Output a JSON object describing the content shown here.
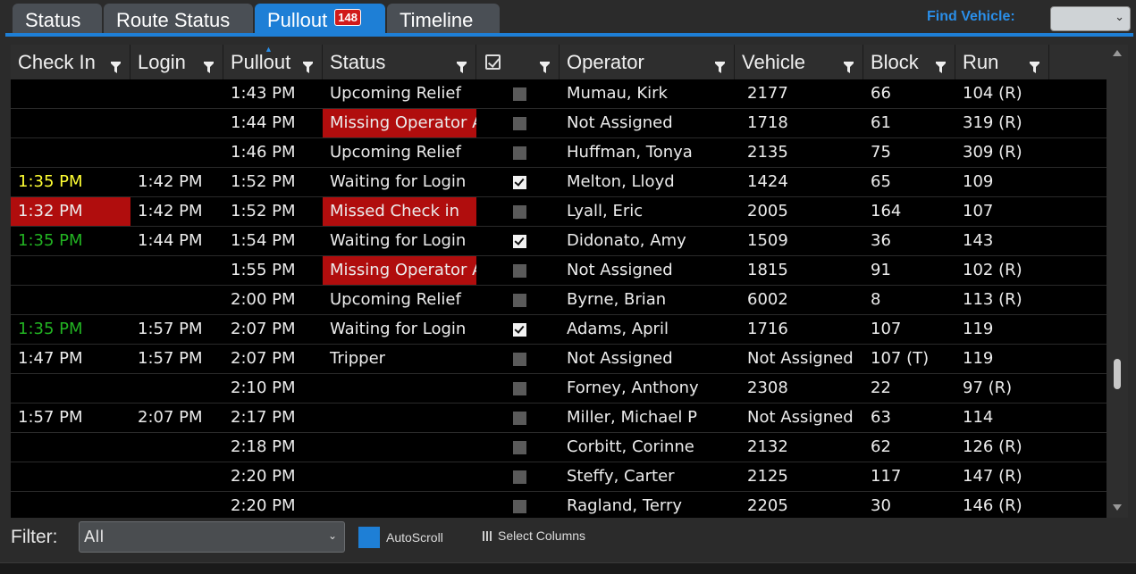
{
  "tabs": [
    {
      "label": "Status",
      "badge": null
    },
    {
      "label": "Route Status",
      "badge": null
    },
    {
      "label": "Pullout",
      "badge": "148"
    },
    {
      "label": "Timeline",
      "badge": null
    }
  ],
  "find_vehicle": {
    "label": "Find Vehicle:",
    "value": ""
  },
  "columns": [
    "Check In",
    "Login",
    "Pullout",
    "Status",
    "",
    "Operator",
    "Vehicle",
    "Block",
    "Run"
  ],
  "rows": [
    {
      "checkin": "",
      "checkin_style": "",
      "login": "",
      "pullout": "1:43 PM",
      "status": "Upcoming Relief",
      "status_style": "",
      "checked": false,
      "operator": "Mumau, Kirk",
      "vehicle": "2177",
      "block": "66",
      "run": "104 (R)"
    },
    {
      "checkin": "",
      "checkin_style": "",
      "login": "",
      "pullout": "1:44 PM",
      "status": "Missing Operator Assignment",
      "status_style": "red",
      "checked": false,
      "operator": "Not Assigned",
      "vehicle": "1718",
      "block": "61",
      "run": "319 (R)"
    },
    {
      "checkin": "",
      "checkin_style": "",
      "login": "",
      "pullout": "1:46 PM",
      "status": "Upcoming Relief",
      "status_style": "",
      "checked": false,
      "operator": "Huffman, Tonya",
      "vehicle": "2135",
      "block": "75",
      "run": "309 (R)"
    },
    {
      "checkin": "1:35 PM",
      "checkin_style": "yellow",
      "login": "1:42 PM",
      "pullout": "1:52 PM",
      "status": "Waiting for Login",
      "status_style": "",
      "checked": true,
      "operator": "Melton, Lloyd",
      "vehicle": "1424",
      "block": "65",
      "run": "109"
    },
    {
      "checkin": "1:32 PM",
      "checkin_style": "red",
      "login": "1:42 PM",
      "pullout": "1:52 PM",
      "status": "Missed Check in",
      "status_style": "red",
      "checked": false,
      "operator": "Lyall, Eric",
      "vehicle": "2005",
      "block": "164",
      "run": "107"
    },
    {
      "checkin": "1:35 PM",
      "checkin_style": "green",
      "login": "1:44 PM",
      "pullout": "1:54 PM",
      "status": "Waiting for Login",
      "status_style": "",
      "checked": true,
      "operator": "Didonato, Amy",
      "vehicle": "1509",
      "block": "36",
      "run": "143"
    },
    {
      "checkin": "",
      "checkin_style": "",
      "login": "",
      "pullout": "1:55 PM",
      "status": "Missing Operator Assignment",
      "status_style": "red",
      "checked": false,
      "operator": "Not Assigned",
      "vehicle": "1815",
      "block": "91",
      "run": "102 (R)"
    },
    {
      "checkin": "",
      "checkin_style": "",
      "login": "",
      "pullout": "2:00 PM",
      "status": "Upcoming Relief",
      "status_style": "",
      "checked": false,
      "operator": "Byrne, Brian",
      "vehicle": "6002",
      "block": "8",
      "run": "113 (R)"
    },
    {
      "checkin": "1:35 PM",
      "checkin_style": "green",
      "login": "1:57 PM",
      "pullout": "2:07 PM",
      "status": "Waiting for Login",
      "status_style": "",
      "checked": true,
      "operator": "Adams, April",
      "vehicle": "1716",
      "block": "107",
      "run": "119"
    },
    {
      "checkin": "1:47 PM",
      "checkin_style": "",
      "login": "1:57 PM",
      "pullout": "2:07 PM",
      "status": "Tripper",
      "status_style": "",
      "checked": false,
      "operator": "Not Assigned",
      "vehicle": "Not Assigned",
      "block": "107 (T)",
      "run": "119"
    },
    {
      "checkin": "",
      "checkin_style": "",
      "login": "",
      "pullout": "2:10 PM",
      "status": "",
      "status_style": "",
      "checked": false,
      "operator": "Forney, Anthony",
      "vehicle": "2308",
      "block": "22",
      "run": "97 (R)"
    },
    {
      "checkin": "1:57 PM",
      "checkin_style": "",
      "login": "2:07 PM",
      "pullout": "2:17 PM",
      "status": "",
      "status_style": "",
      "checked": false,
      "operator": "Miller, Michael P",
      "vehicle": "Not Assigned",
      "block": "63",
      "run": "114"
    },
    {
      "checkin": "",
      "checkin_style": "",
      "login": "",
      "pullout": "2:18 PM",
      "status": "",
      "status_style": "",
      "checked": false,
      "operator": "Corbitt, Corinne",
      "vehicle": "2132",
      "block": "62",
      "run": "126 (R)"
    },
    {
      "checkin": "",
      "checkin_style": "",
      "login": "",
      "pullout": "2:20 PM",
      "status": "",
      "status_style": "",
      "checked": false,
      "operator": "Steffy, Carter",
      "vehicle": "2125",
      "block": "117",
      "run": "147 (R)"
    },
    {
      "checkin": "",
      "checkin_style": "",
      "login": "",
      "pullout": "2:20 PM",
      "status": "",
      "status_style": "",
      "checked": false,
      "operator": "Ragland, Terry",
      "vehicle": "2205",
      "block": "30",
      "run": "146 (R)"
    }
  ],
  "footer": {
    "filter_label": "Filter:",
    "filter_value": "All",
    "autoscroll_label": "AutoScroll",
    "select_columns_label": "Select Columns"
  },
  "colors": {
    "accent": "#1e7fd6",
    "alert": "#b00d0d",
    "warn_text": "#ffff33",
    "ok_text": "#22b322"
  }
}
